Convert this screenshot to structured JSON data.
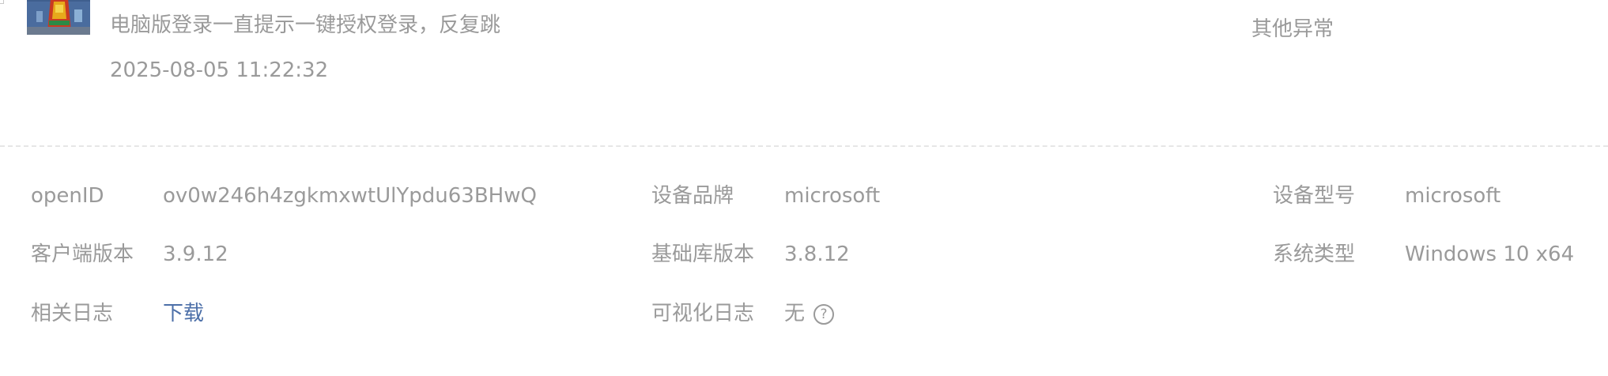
{
  "feedback": {
    "text": "电脑版登录一直提示一键授权登录，反复跳",
    "time": "2025-08-05 11:22:32",
    "category": "其他异常"
  },
  "details": {
    "openid": {
      "label": "openID",
      "value": "ov0w246h4zgkmxwtUlYpdu63BHwQ"
    },
    "device_brand": {
      "label": "设备品牌",
      "value": "microsoft"
    },
    "device_model": {
      "label": "设备型号",
      "value": "microsoft"
    },
    "client_version": {
      "label": "客户端版本",
      "value": "3.9.12"
    },
    "lib_version": {
      "label": "基础库版本",
      "value": "3.8.12"
    },
    "system_type": {
      "label": "系统类型",
      "value": "Windows 10 x64"
    },
    "related_logs": {
      "label": "相关日志",
      "link": "下载"
    },
    "visual_logs": {
      "label": "可视化日志",
      "value": "无"
    }
  },
  "colors": {
    "text": "#9a9a9a",
    "link": "#4c6fa8",
    "divider": "#e6e6e6"
  }
}
